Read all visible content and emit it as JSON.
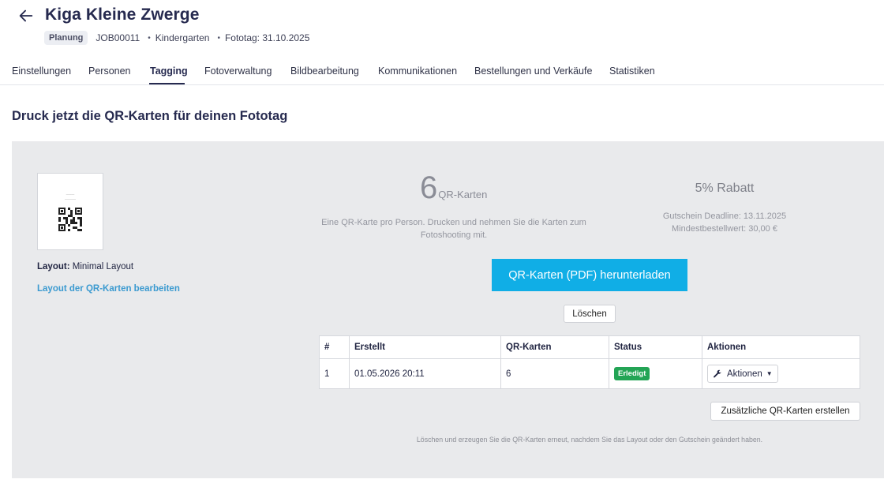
{
  "header": {
    "title": "Kiga Kleine Zwerge",
    "status_badge": "Planung",
    "job_id": "JOB00011",
    "category": "Kindergarten",
    "fototag": "Fototag: 31.10.2025"
  },
  "tabs": [
    {
      "label": "Einstellungen"
    },
    {
      "label": "Personen"
    },
    {
      "label": "Tagging",
      "active": true
    },
    {
      "label": "Fotoverwaltung"
    },
    {
      "label": "Bildbearbeitung"
    },
    {
      "label": "Kommunikationen"
    },
    {
      "label": "Bestellungen und Verkäufe"
    },
    {
      "label": "Statistiken"
    }
  ],
  "section_title": "Druck jetzt die QR-Karten für deinen Fototag",
  "layout": {
    "label_prefix": "Layout:",
    "label_value": "Minimal Layout",
    "edit_link": "Layout der QR-Karten bearbeiten"
  },
  "cards": {
    "count": "6",
    "unit": "QR-Karten",
    "description": "Eine QR-Karte pro Person. Drucken und nehmen Sie die Karten zum Fotoshooting mit."
  },
  "discount": {
    "title": "5% Rabatt",
    "deadline": "Gutschein Deadline: 13.11.2025",
    "min_order": "Mindestbestellwert: 30,00 €"
  },
  "buttons": {
    "download": "QR-Karten (PDF) herunterladen",
    "delete": "Löschen",
    "extra": "Zusätzliche QR-Karten erstellen",
    "actions": "Aktionen"
  },
  "table": {
    "headers": [
      "#",
      "Erstellt",
      "QR-Karten",
      "Status",
      "Aktionen"
    ],
    "rows": [
      {
        "num": "1",
        "created": "01.05.2026 20:11",
        "cards": "6",
        "status": "Erledigt"
      }
    ]
  },
  "hint": "Löschen und erzeugen Sie die QR-Karten erneut, nachdem Sie das Layout oder den Gutschein geändert haben.",
  "colors": {
    "accent": "#10aee6",
    "status_done": "#23a455",
    "link": "#3b9ad0",
    "title": "#262a4f",
    "panel_bg": "#e9eaec"
  }
}
